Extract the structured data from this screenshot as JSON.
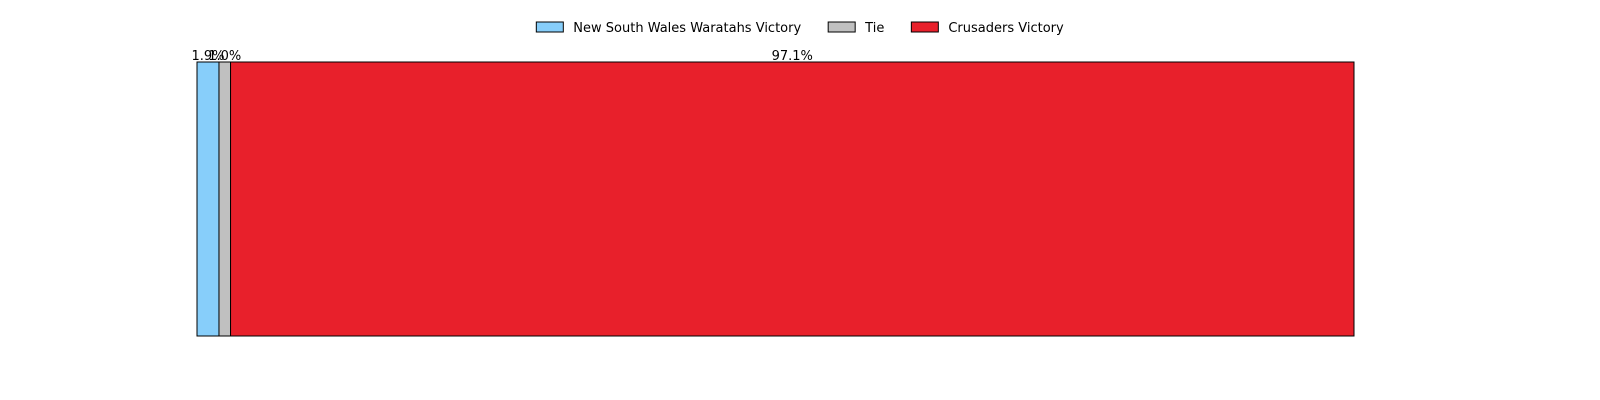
{
  "chart_data": {
    "type": "bar",
    "orientation": "horizontal-stacked",
    "title": "",
    "xlabel": "",
    "ylabel": "",
    "xlim": [
      0,
      100
    ],
    "grid": false,
    "legend_position": "top-center",
    "unit": "%",
    "series": [
      {
        "name": "New South Wales Waratahs Victory",
        "value": 1.9,
        "label": "1.9%",
        "color": "#87CEFA"
      },
      {
        "name": "Tie",
        "value": 1.0,
        "label": "1.0%",
        "color": "#C0C0C0"
      },
      {
        "name": "Crusaders Victory",
        "value": 97.1,
        "label": "97.1%",
        "color": "#E8202B"
      }
    ]
  }
}
